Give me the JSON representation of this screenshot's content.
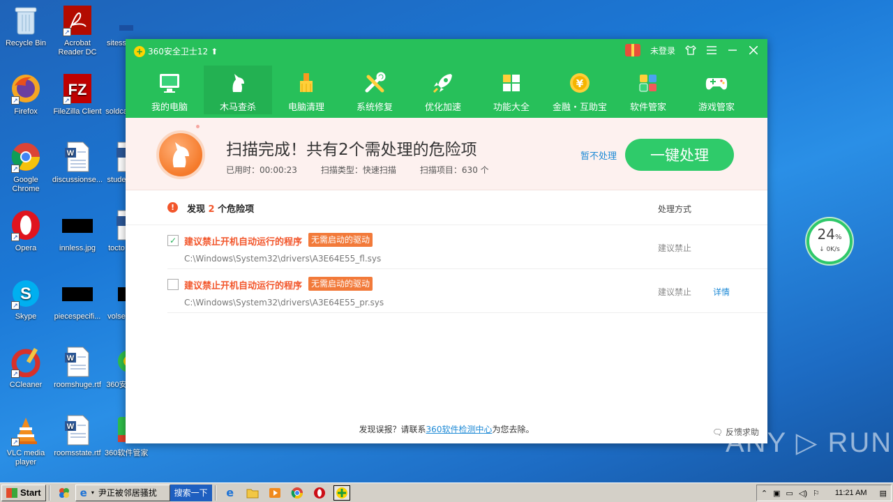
{
  "desktop": {
    "icons": [
      {
        "label": "Recycle Bin"
      },
      {
        "label": "Acrobat Reader DC"
      },
      {
        "label": "sitess"
      },
      {
        "label": "Firefox"
      },
      {
        "label": "FileZilla Client"
      },
      {
        "label": "soldca"
      },
      {
        "label": "Google Chrome"
      },
      {
        "label": "discussionse..."
      },
      {
        "label": "stude"
      },
      {
        "label": "Opera"
      },
      {
        "label": "innless.jpg"
      },
      {
        "label": "tocto"
      },
      {
        "label": "Skype"
      },
      {
        "label": "piecespecifi..."
      },
      {
        "label": "volse"
      },
      {
        "label": "CCleaner"
      },
      {
        "label": "roomshuge.rtf"
      },
      {
        "label": "360安"
      },
      {
        "label": "VLC media player"
      },
      {
        "label": "roomsstate.rtf"
      },
      {
        "label": "360软件管家"
      }
    ]
  },
  "app": {
    "title": "360安全卫士12",
    "login": "未登录",
    "nav": [
      {
        "label": "我的电脑"
      },
      {
        "label": "木马查杀"
      },
      {
        "label": "电脑清理"
      },
      {
        "label": "系统修复"
      },
      {
        "label": "优化加速"
      },
      {
        "label": "功能大全"
      },
      {
        "label": "金融・互助宝"
      },
      {
        "label": "软件管家"
      },
      {
        "label": "游戏管家"
      }
    ],
    "banner": {
      "title": "扫描完成！共有2个需处理的危险项",
      "elapsed": "已用时：00:00:23",
      "scan_type": "扫描类型：快速扫描",
      "scan_items": "扫描项目：630 个",
      "skip": "暂不处理",
      "onekey": "一键处理"
    },
    "list": {
      "found_prefix": "发现",
      "found_count": "2",
      "found_suffix": "个危险项",
      "handle_header": "处理方式",
      "rows": [
        {
          "checked": "✓",
          "title": "建议禁止开机自动运行的程序",
          "tag": "无需启动的驱动",
          "path": "C:\\Windows\\System32\\drivers\\A3E64E55_fl.sys",
          "action": "建议禁止",
          "detail": ""
        },
        {
          "checked": "",
          "title": "建议禁止开机自动运行的程序",
          "tag": "无需启动的驱动",
          "path": "C:\\Windows\\System32\\drivers\\A3E64E55_pr.sys",
          "action": "建议禁止",
          "detail": "详情"
        }
      ]
    },
    "footer": {
      "prefix": "发现误报？请联系",
      "link": "360软件检测中心",
      "suffix": "为您去除。",
      "feedback": "反馈求助"
    }
  },
  "speed_widget": {
    "percent": "24",
    "percent_sign": "%",
    "rate": "↓ 0K/s"
  },
  "watermark": "ANY ▷ RUN",
  "taskbar": {
    "start": "Start",
    "task_label": "尹正被邻居骚扰",
    "search": "搜索一下",
    "clock": "11:21 AM"
  },
  "colors": {
    "app_green": "#27c05a",
    "danger_orange": "#f2562b",
    "link_blue": "#1e8ad6"
  }
}
